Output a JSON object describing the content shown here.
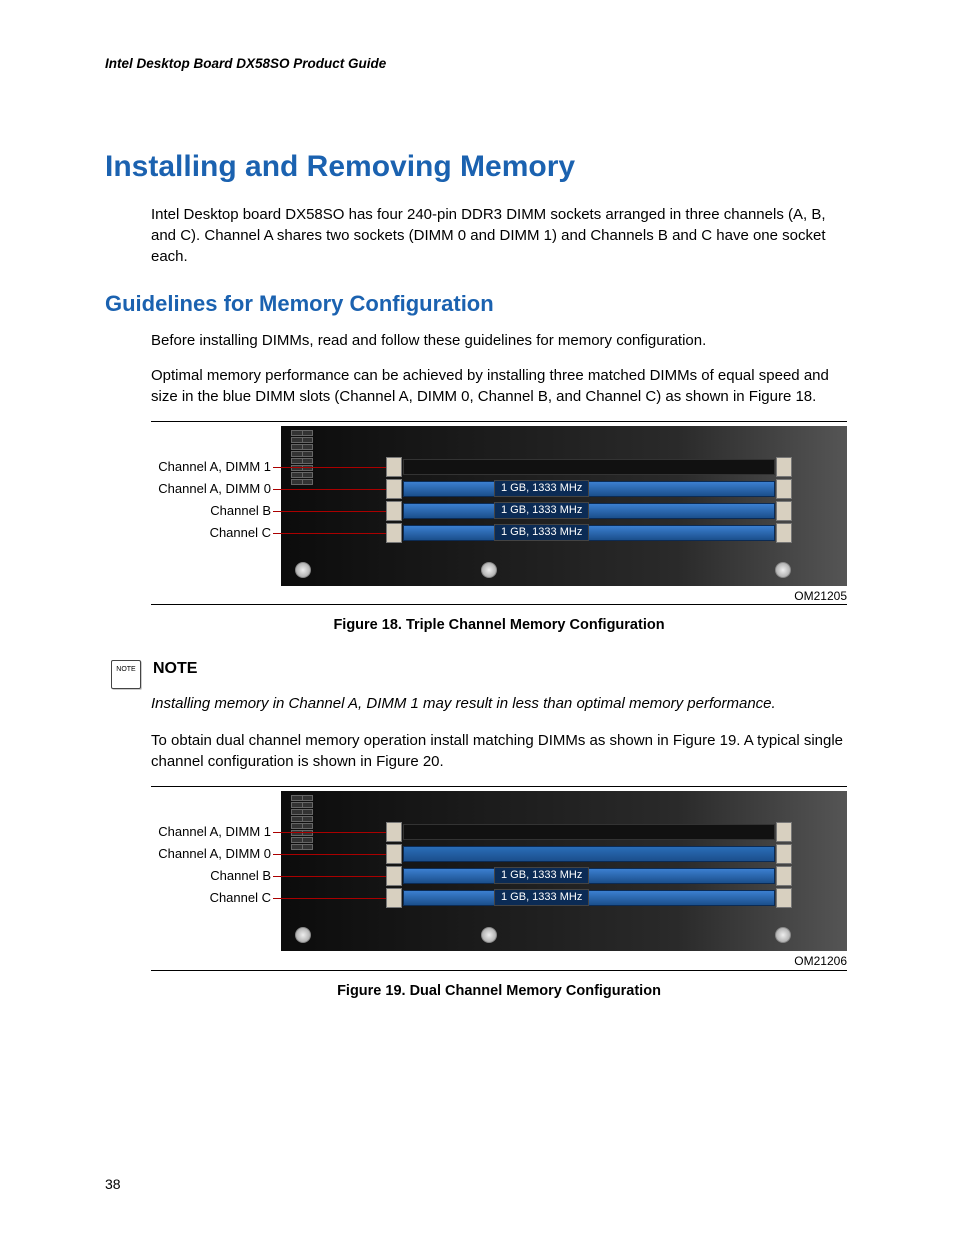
{
  "header": "Intel Desktop Board DX58SO Product Guide",
  "h1": "Installing and Removing Memory",
  "intro": "Intel Desktop board DX58SO has four 240-pin DDR3 DIMM sockets arranged in three channels (A, B, and C).  Channel A shares two sockets (DIMM 0 and DIMM 1) and Channels B and C have one socket each.",
  "h2": "Guidelines for Memory Configuration",
  "para2": "Before installing DIMMs, read and follow these guidelines for memory configuration.",
  "para3": "Optimal memory performance can be achieved by installing three matched DIMMs of equal speed and size in the blue DIMM slots (Channel A, DIMM 0, Channel B, and Channel C) as shown in Figure 18.",
  "fig18": {
    "labels": {
      "a1": "Channel A, DIMM 1",
      "a0": "Channel A, DIMM 0",
      "b": "Channel B",
      "c": "Channel C"
    },
    "mem_tag": "1 GB, 1333 MHz",
    "om": "OM21205",
    "caption": "Figure 18.  Triple Channel Memory Configuration"
  },
  "note": {
    "icon_text": "NOTE",
    "title": "NOTE",
    "body": "Installing memory in Channel A, DIMM 1 may result in less than optimal memory performance."
  },
  "para4": "To obtain dual channel memory operation install matching DIMMs as shown in Figure 19.  A typical single channel configuration is shown in Figure 20.",
  "fig19": {
    "labels": {
      "a1": "Channel A, DIMM 1",
      "a0": "Channel A, DIMM 0",
      "b": "Channel B",
      "c": "Channel C"
    },
    "mem_tag": "1 GB, 1333 MHz",
    "om": "OM21206",
    "caption": "Figure 19.  Dual Channel Memory Configuration"
  },
  "page_number": "38"
}
